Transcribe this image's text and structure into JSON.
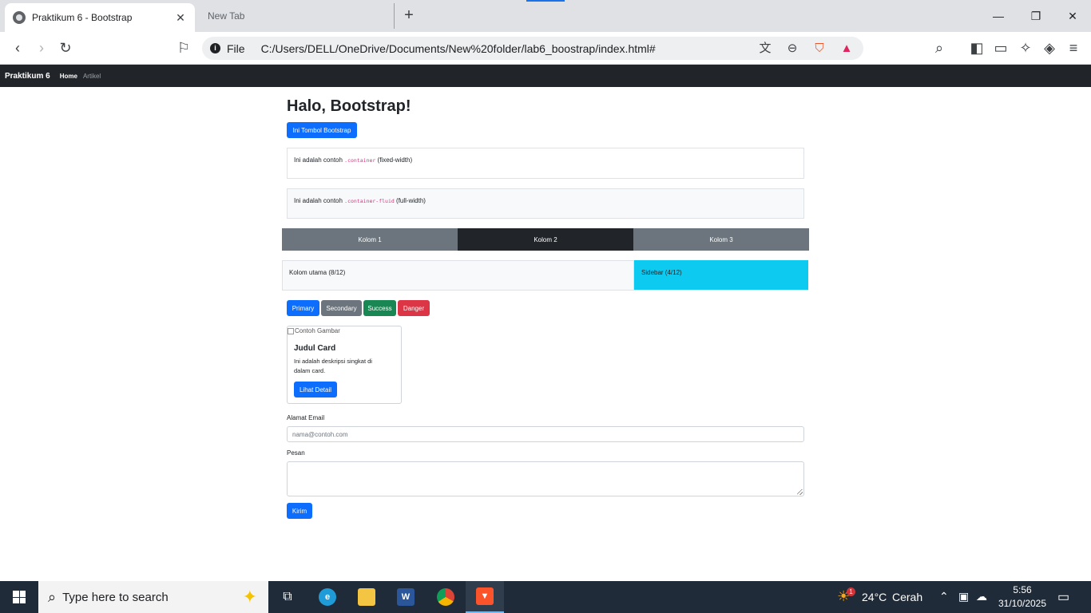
{
  "browser": {
    "active_tab_title": "Praktikum 6 - Bootstrap",
    "inactive_tab_title": "New Tab",
    "new_tab_symbol": "+",
    "omnibox_scheme": "File",
    "url": "C:/Users/DELL/OneDrive/Documents/New%20folder/lab6_boostrap/index.html#"
  },
  "navbar": {
    "brand": "Praktikum 6",
    "links": [
      "Home",
      "Artikel"
    ]
  },
  "page": {
    "heading": "Halo, Bootstrap!",
    "hero_button": "Ini Tombol Bootstrap",
    "container_box": {
      "prefix": "Ini adalah contoh",
      "code": ".container",
      "suffix": "(fixed-width)"
    },
    "fluid_box": {
      "prefix": "Ini adalah contoh",
      "code": ".container-fluid",
      "suffix": "(full-width)"
    },
    "columns": [
      "Kolom 1",
      "Kolom 2",
      "Kolom 3"
    ],
    "main_column": "Kolom utama (8/12)",
    "sidebar_column": "Sidebar (4/12)",
    "buttons": [
      "Primary",
      "Secondary",
      "Success",
      "Danger"
    ],
    "card": {
      "img_alt": "Contoh Gambar",
      "title": "Judul Card",
      "text": "Ini adalah deskripsi singkat di dalam card.",
      "button": "Lihat Detail"
    },
    "form": {
      "email_label": "Alamat Email",
      "email_placeholder": "nama@contoh.com",
      "message_label": "Pesan",
      "submit": "Kirim"
    }
  },
  "taskbar": {
    "search_placeholder": "Type here to search",
    "weather_badge": "1",
    "temperature": "24°C",
    "weather": "Cerah",
    "time": "5:56",
    "date": "31/10/2025"
  },
  "colors": {
    "primary": "#0d6efd",
    "secondary": "#6c757d",
    "success": "#198754",
    "danger": "#dc3545",
    "dark": "#212529",
    "info": "#0dcaf0"
  }
}
